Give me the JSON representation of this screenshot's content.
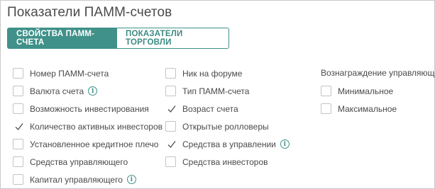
{
  "page": {
    "title": "Показатели ПАММ-счетов"
  },
  "tabs": [
    {
      "label": "СВОЙСТВА ПАММ-СЧЕТА",
      "active": true
    },
    {
      "label": "ПОКАЗАТЕЛИ ТОРГОВЛИ",
      "active": false
    }
  ],
  "columns": {
    "col1": [
      {
        "label": "Номер ПАММ-счета",
        "checked": false,
        "info": false
      },
      {
        "label": "Валюта счета",
        "checked": false,
        "info": true
      },
      {
        "label": "Возможность инвестирования",
        "checked": false,
        "info": false
      },
      {
        "label": "Количество активных инвесторов",
        "checked": true,
        "info": false
      },
      {
        "label": "Установленное кредитное плечо",
        "checked": false,
        "info": false
      },
      {
        "label": "Средства управляющего",
        "checked": false,
        "info": false
      },
      {
        "label": "Капитал управляющего",
        "checked": false,
        "info": true
      }
    ],
    "col2": [
      {
        "label": "Ник на форуме",
        "checked": false,
        "info": false
      },
      {
        "label": "Тип ПАММ-счета",
        "checked": false,
        "info": false
      },
      {
        "label": "Возраст счета",
        "checked": true,
        "info": false
      },
      {
        "label": "Открытые ролловеры",
        "checked": false,
        "info": false
      },
      {
        "label": "Средства в управлении",
        "checked": true,
        "info": true
      },
      {
        "label": "Средства инвесторов",
        "checked": false,
        "info": false
      }
    ],
    "col3": {
      "heading": "Вознаграждение управляющего",
      "items": [
        {
          "label": "Минимальное",
          "checked": false,
          "info": false
        },
        {
          "label": "Максимальное",
          "checked": false,
          "info": false
        }
      ]
    }
  },
  "icons": {
    "info_glyph": "i"
  },
  "colors": {
    "accent": "#3f9189",
    "text": "#4a4a4a",
    "checkbox_border": "#c4c4c4"
  }
}
